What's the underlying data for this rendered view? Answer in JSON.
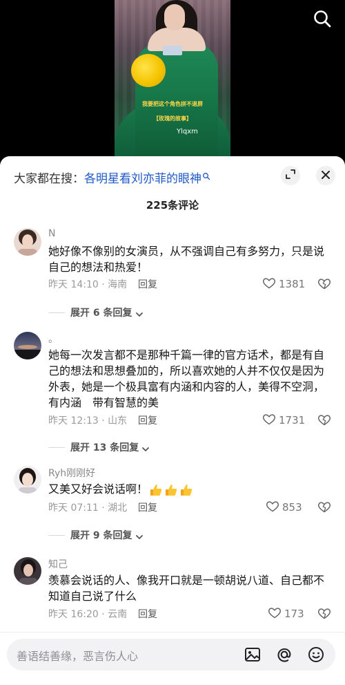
{
  "video": {
    "subtitle_line1": "我要把这个角色拼不退屏",
    "subtitle_line2": "【玫瑰的故事】",
    "watermark": "Ylqxm",
    "search_icon": "search-icon"
  },
  "sheet": {
    "suggest_prefix": "大家都在搜：",
    "suggest_link": "各明星看刘亦菲的眼神",
    "expand_icon": "expand-icon",
    "close_icon": "close-icon",
    "comment_count": "225条评论"
  },
  "comments": [
    {
      "username": "N",
      "text": "她好像不像别的女演员，从不强调自己有多努力，只是说自己的想法和热爱！",
      "time_location": "昨天 14:10 · 海南",
      "reply": "回复",
      "likes": "1381",
      "expand": "展开 6 条回复"
    },
    {
      "username": "。",
      "text": "她每一次发言都不是那种千篇一律的官方话术，都是有自己的想法和思想叠加的，所以喜欢她的人并不仅仅是因为外表，她是一个极具富有内涵和内容的人，美得不空洞，有内涵　带有智慧的美",
      "time_location": "昨天 12:13 · 山东",
      "reply": "回复",
      "likes": "1731",
      "expand": "展开 13 条回复"
    },
    {
      "username": "Ryh刚刚好",
      "text": "又美又好会说话啊！",
      "time_location": "昨天 07:11 · 湖北",
      "reply": "回复",
      "likes": "853",
      "expand": "展开 9 条回复"
    },
    {
      "username": "知己",
      "text": "羡慕会说话的人、像我开口就是一顿胡说八道、自己都不知道自己说了什么",
      "time_location": "昨天 16:20 · 云南",
      "reply": "回复",
      "likes": "173"
    }
  ],
  "input": {
    "placeholder": "善语结善缘，恶言伤人心",
    "image_icon": "image-icon",
    "at_icon": "at-icon",
    "emoji_icon": "emoji-icon"
  },
  "colors": {
    "link_blue": "#1e58c8",
    "dress_green": "#157346",
    "subtitle_yellow": "#ffd84a"
  }
}
